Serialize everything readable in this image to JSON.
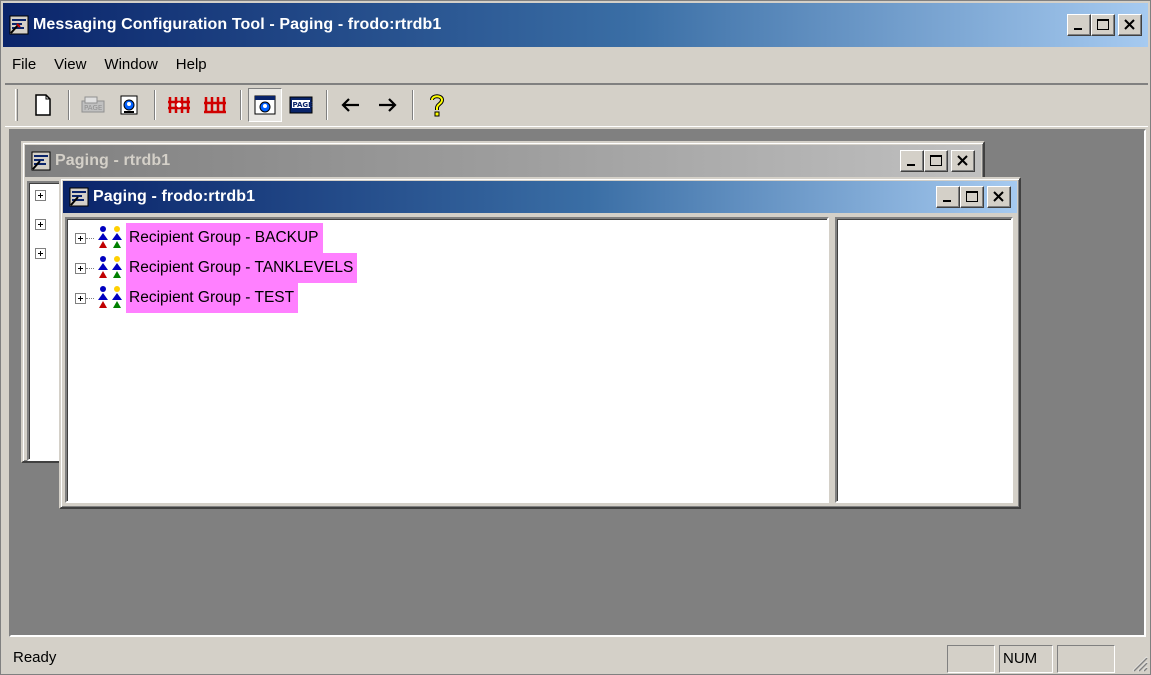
{
  "app": {
    "title": "Messaging Configuration Tool  - Paging - frodo:rtrdb1"
  },
  "menu": [
    "File",
    "View",
    "Window",
    "Help"
  ],
  "toolbar": {
    "buttons": [
      "new-document-icon",
      "page-disabled-icon",
      "page-preview-icon",
      "recipient-group-add-icon",
      "recipient-group-icon",
      "pager-window-icon",
      "page-icon",
      "back-arrow-icon",
      "forward-arrow-icon",
      "help-icon"
    ],
    "back_glyph": "←",
    "forward_glyph": "→",
    "help_glyph": "?"
  },
  "windows": {
    "back": {
      "title": "Paging - rtrdb1"
    },
    "front": {
      "title": "Paging - frodo:rtrdb1"
    }
  },
  "tree": {
    "items": [
      {
        "label": "Recipient Group - BACKUP"
      },
      {
        "label": "Recipient Group - TANKLEVELS"
      },
      {
        "label": "Recipient Group - TEST"
      }
    ]
  },
  "status": {
    "text": "Ready",
    "num": "NUM"
  },
  "colors": {
    "title_active": "#0a246a",
    "highlight": "#ff80ff",
    "face": "#d4d0c8",
    "mdi_bg": "#808080"
  }
}
